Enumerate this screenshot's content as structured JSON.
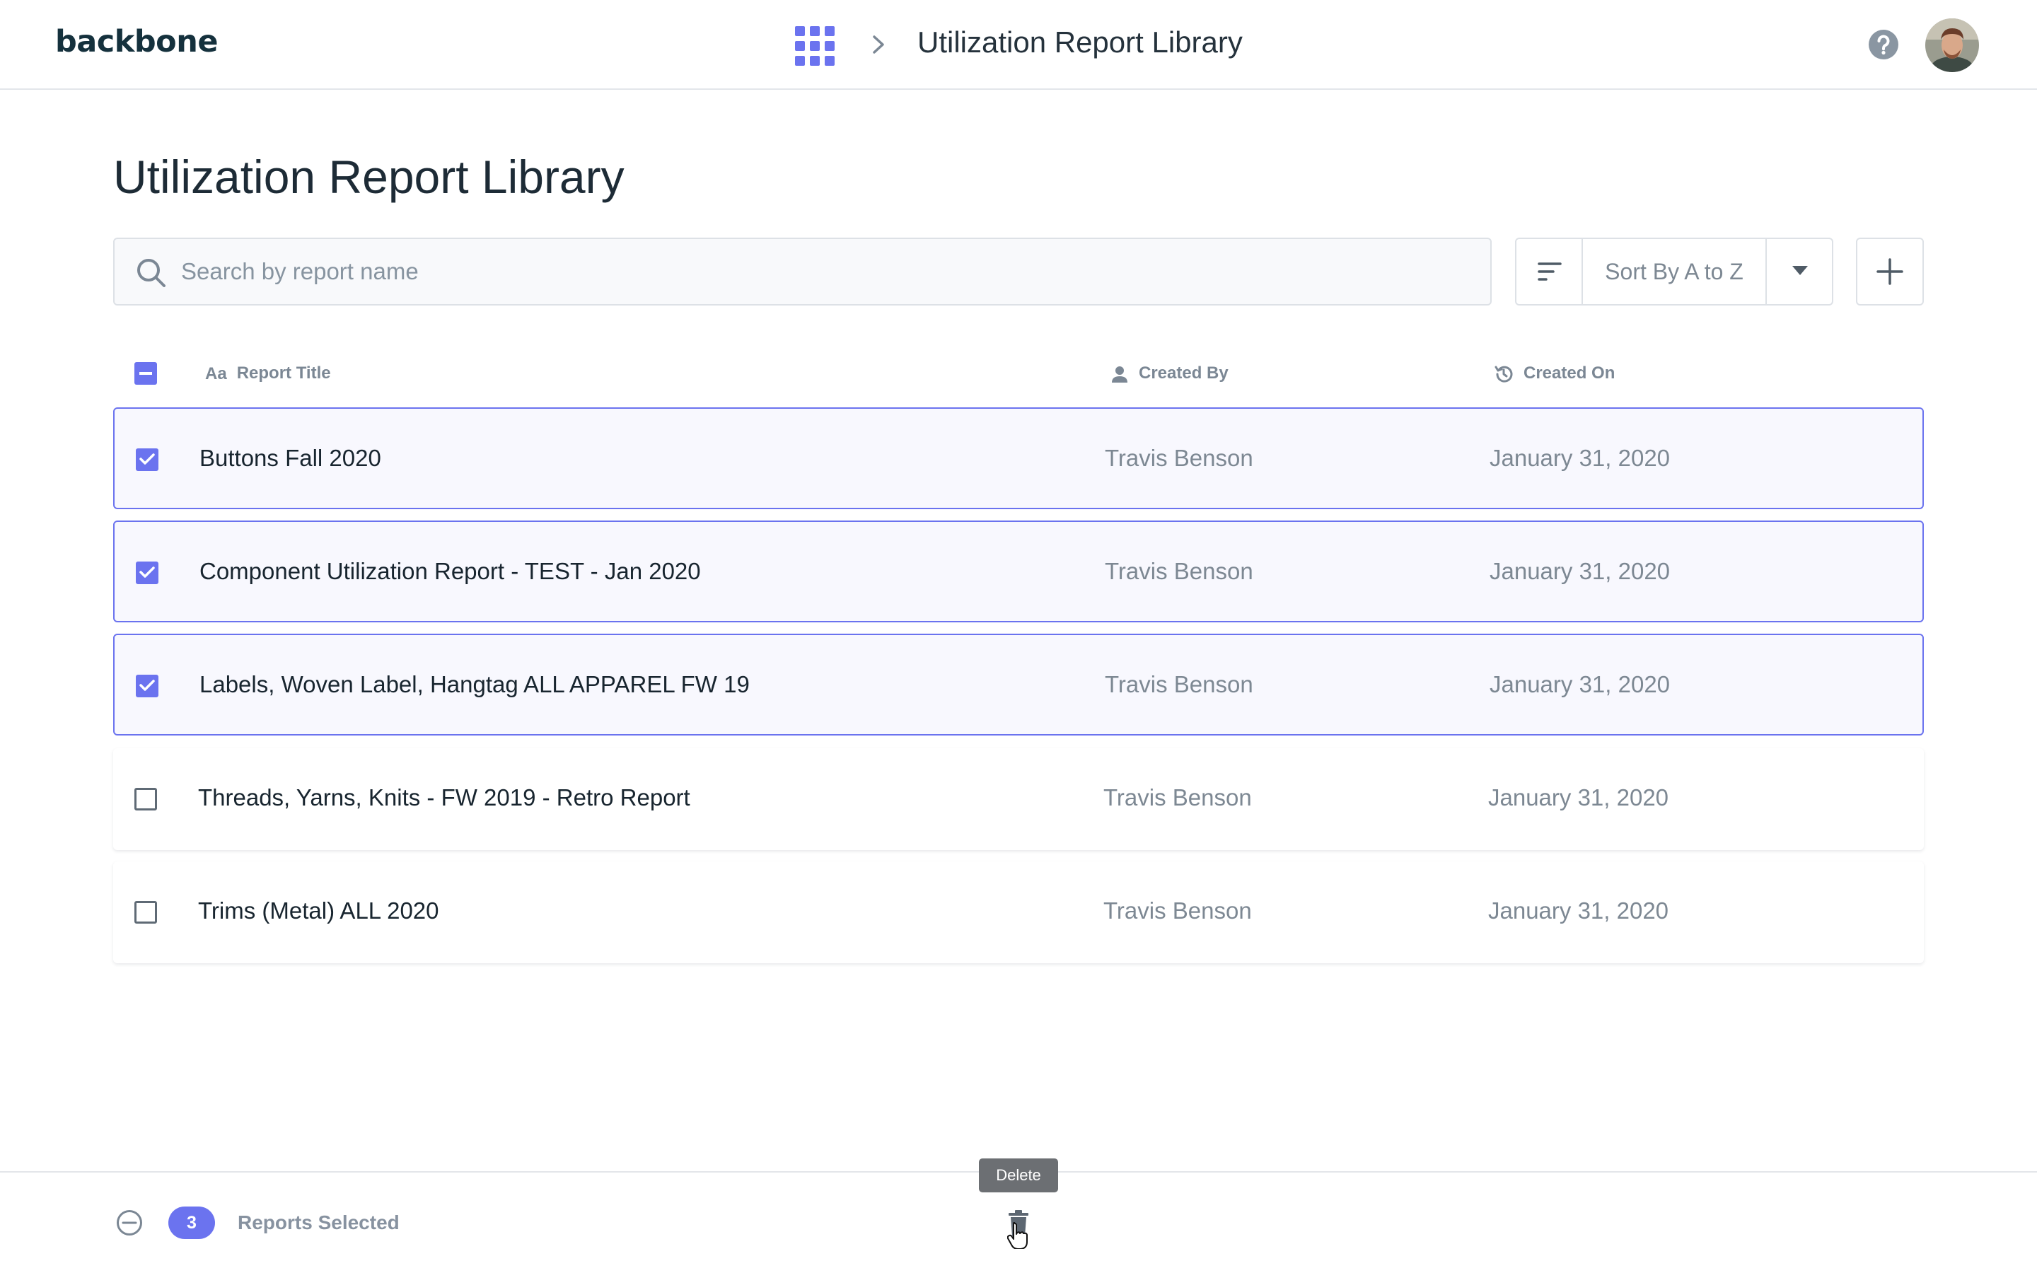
{
  "app": {
    "logo": "backbone",
    "header_title": "Utilization Report Library",
    "icons": [
      "apps-grid-icon",
      "chevron-right-icon",
      "help-icon",
      "avatar"
    ]
  },
  "main": {
    "page_title": "Utilization Report Library",
    "search": {
      "placeholder": "Search by report name",
      "value": ""
    },
    "sort": {
      "selected": "Sort By A to Z"
    }
  },
  "table": {
    "columns": {
      "title": "Report Title",
      "title_icon": "Aa",
      "created_by": "Created By",
      "created_on": "Created On"
    },
    "rows": [
      {
        "title": "Buttons Fall 2020",
        "created_by": "Travis Benson",
        "created_on": "January 31, 2020",
        "selected": true
      },
      {
        "title": "Component Utilization Report - TEST - Jan 2020",
        "created_by": "Travis Benson",
        "created_on": "January 31, 2020",
        "selected": true
      },
      {
        "title": "Labels, Woven Label, Hangtag ALL APPAREL FW 19",
        "created_by": "Travis Benson",
        "created_on": "January 31, 2020",
        "selected": true
      },
      {
        "title": "Threads, Yarns, Knits - FW 2019 - Retro Report",
        "created_by": "Travis Benson",
        "created_on": "January 31, 2020",
        "selected": false
      },
      {
        "title": "Trims (Metal) ALL 2020",
        "created_by": "Travis Benson",
        "created_on": "January 31, 2020",
        "selected": false
      }
    ]
  },
  "footer": {
    "selected_count": "3",
    "selected_label": "Reports Selected",
    "tooltip": "Delete"
  },
  "colors": {
    "accent": "#6b73ef",
    "text_primary": "#1d2b36",
    "text_muted": "#7d8893",
    "border": "#dde1e6"
  }
}
